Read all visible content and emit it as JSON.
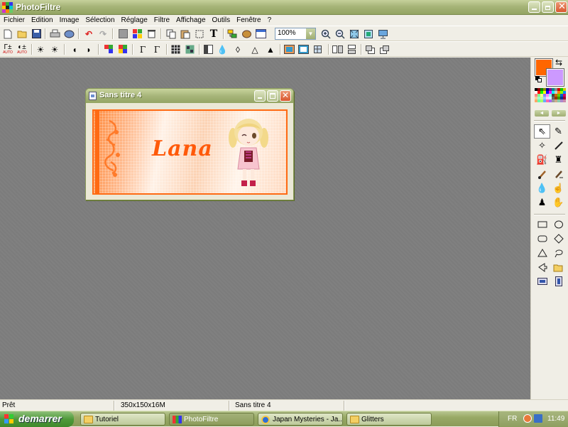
{
  "app": {
    "title": "PhotoFiltre"
  },
  "menu": [
    "Fichier",
    "Edition",
    "Image",
    "Sélection",
    "Réglage",
    "Filtre",
    "Affichage",
    "Outils",
    "Fenêtre",
    "?"
  ],
  "toolbar": {
    "zoom_value": "100%",
    "row1_icons": [
      "new-icon",
      "open-icon",
      "save-icon",
      "print-icon",
      "scan-icon",
      "undo-icon",
      "redo-icon",
      "grey-square-icon",
      "color-grid-icon",
      "trash-icon",
      "copy-icon",
      "paste-icon",
      "crop-icon",
      "text-tool-icon",
      "layers-icon",
      "filter-bug-icon",
      "window-icon",
      "zoom-in-icon",
      "zoom-out-icon",
      "fit-icon",
      "fullscreen-icon",
      "monitor-icon"
    ],
    "row2_icons": [
      "auto-levels-icon",
      "auto-contrast-icon",
      "brightness-minus-icon",
      "brightness-plus-icon",
      "contrast-minus-icon",
      "contrast-plus-icon",
      "saturation-minus-icon",
      "saturation-plus-icon",
      "gamma-minus-icon",
      "gamma-plus-icon",
      "grid-icon",
      "mosaic-icon",
      "invert-icon",
      "drop-icon",
      "drop-outline-icon",
      "triangle-icon",
      "triangle-sharp-icon",
      "image-effect-icon",
      "frame-icon",
      "transform-icon",
      "flip-h-icon",
      "flip-v-icon",
      "rotate-left-icon",
      "rotate-right-icon"
    ],
    "auto_label": "AUTO"
  },
  "colors": {
    "foreground": "#ff6600",
    "background": "#cc99ff"
  },
  "document": {
    "title": "Sans titre 4",
    "canvas_text": "Lana"
  },
  "statusbar": {
    "state": "Prêt",
    "dimensions": "350x150x16M",
    "doc_name": "Sans titre 4"
  },
  "taskbar": {
    "start_label": "demarrer",
    "tasks": [
      {
        "label": "Tutoriel",
        "icon": "folder-icon",
        "active": false
      },
      {
        "label": "PhotoFiltre",
        "icon": "photofiltre-icon",
        "active": true
      },
      {
        "label": "Japan Mysteries - Ja...",
        "icon": "ie-icon",
        "active": false
      },
      {
        "label": "Glitters",
        "icon": "folder-icon",
        "active": false
      }
    ],
    "language": "FR",
    "clock": "11:49"
  }
}
